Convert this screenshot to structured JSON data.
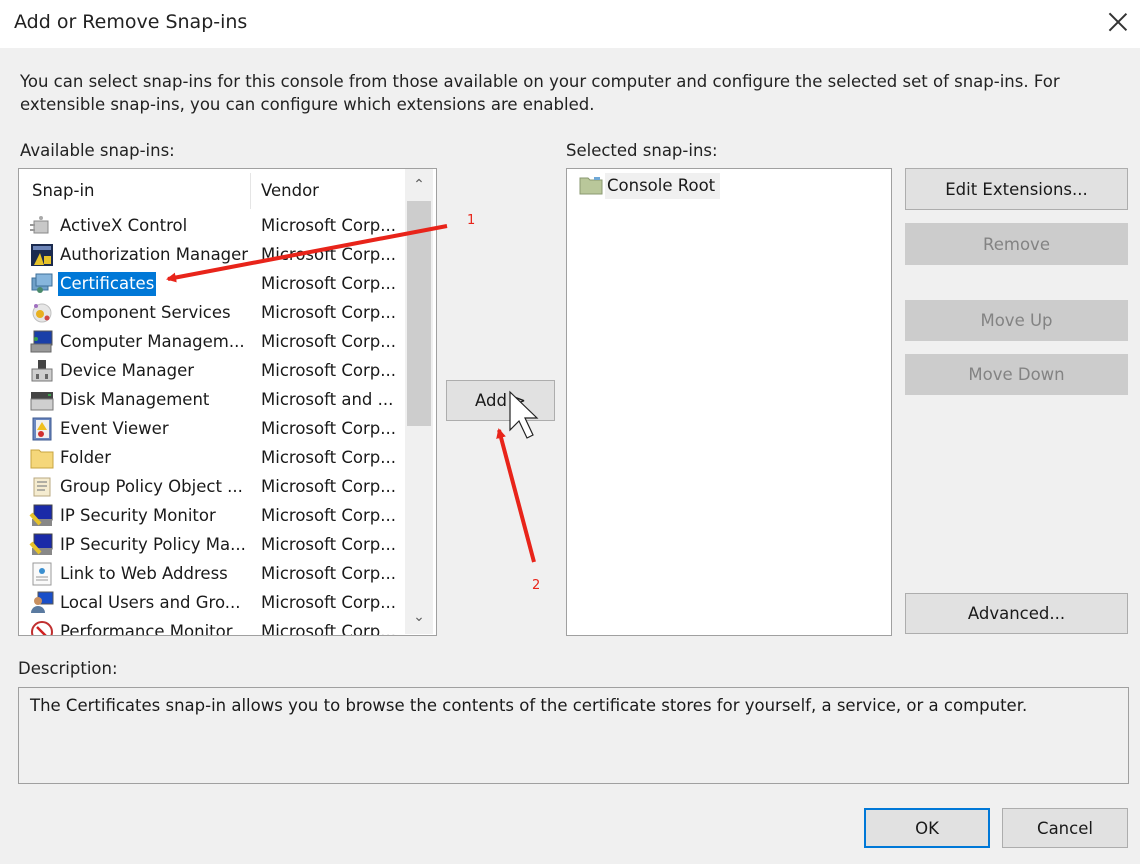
{
  "window": {
    "title": "Add or Remove Snap-ins",
    "close_icon": "close-icon"
  },
  "intro_text": "You can select snap-ins for this console from those available on your computer and configure the selected set of snap-ins. For extensible snap-ins, you can configure which extensions are enabled.",
  "available": {
    "label": "Available snap-ins:",
    "columns": [
      "Snap-in",
      "Vendor"
    ],
    "items": [
      {
        "name": "ActiveX Control",
        "vendor": "Microsoft Corp...",
        "icon": "activex-control-icon",
        "selected": false
      },
      {
        "name": "Authorization Manager",
        "vendor": "Microsoft Corp...",
        "icon": "authorization-manager-icon",
        "selected": false
      },
      {
        "name": "Certificates",
        "vendor": "Microsoft Corp...",
        "icon": "certificates-icon",
        "selected": true
      },
      {
        "name": "Component Services",
        "vendor": "Microsoft Corp...",
        "icon": "component-services-icon",
        "selected": false
      },
      {
        "name": "Computer Managem...",
        "vendor": "Microsoft Corp...",
        "icon": "computer-management-icon",
        "selected": false
      },
      {
        "name": "Device Manager",
        "vendor": "Microsoft Corp...",
        "icon": "device-manager-icon",
        "selected": false
      },
      {
        "name": "Disk Management",
        "vendor": "Microsoft and ...",
        "icon": "disk-management-icon",
        "selected": false
      },
      {
        "name": "Event Viewer",
        "vendor": "Microsoft Corp...",
        "icon": "event-viewer-icon",
        "selected": false
      },
      {
        "name": "Folder",
        "vendor": "Microsoft Corp...",
        "icon": "folder-icon",
        "selected": false
      },
      {
        "name": "Group Policy Object ...",
        "vendor": "Microsoft Corp...",
        "icon": "group-policy-icon",
        "selected": false
      },
      {
        "name": "IP Security Monitor",
        "vendor": "Microsoft Corp...",
        "icon": "ip-security-monitor-icon",
        "selected": false
      },
      {
        "name": "IP Security Policy Ma...",
        "vendor": "Microsoft Corp...",
        "icon": "ip-security-policy-icon",
        "selected": false
      },
      {
        "name": "Link to Web Address",
        "vendor": "Microsoft Corp...",
        "icon": "web-link-icon",
        "selected": false
      },
      {
        "name": "Local Users and Gro...",
        "vendor": "Microsoft Corp...",
        "icon": "local-users-icon",
        "selected": false
      },
      {
        "name": "Performance Monitor",
        "vendor": "Microsoft Corp...",
        "icon": "performance-monitor-icon",
        "selected": false
      }
    ]
  },
  "add_button": "Add >",
  "selected": {
    "label": "Selected snap-ins:",
    "items": [
      {
        "name": "Console Root",
        "icon": "console-root-folder-icon"
      }
    ]
  },
  "buttons": {
    "edit_extensions": "Edit Extensions...",
    "remove": "Remove",
    "move_up": "Move Up",
    "move_down": "Move Down",
    "advanced": "Advanced...",
    "ok": "OK",
    "cancel": "Cancel"
  },
  "description": {
    "label": "Description:",
    "text": "The Certificates snap-in allows you to browse the contents of the certificate stores for yourself, a service, or a computer."
  },
  "annotations": [
    {
      "label": "1",
      "target": "Certificates"
    },
    {
      "label": "2",
      "target": "Add"
    }
  ],
  "colors": {
    "selection": "#0078d7",
    "annotation": "#e8241a"
  }
}
